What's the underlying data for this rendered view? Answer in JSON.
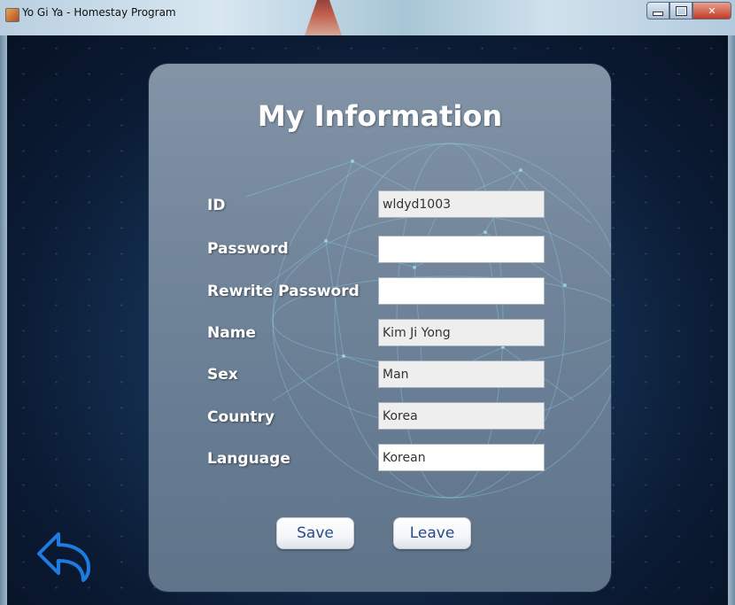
{
  "window": {
    "title": "Yo Gi Ya - Homestay Program",
    "controls": [
      "minimize-icon",
      "maximize-icon",
      "close-icon"
    ]
  },
  "panel": {
    "title": "My Information",
    "fields": [
      {
        "label": "ID",
        "value": "wldyd1003"
      },
      {
        "label": "Password",
        "value": ""
      },
      {
        "label": "Rewrite Password",
        "value": ""
      },
      {
        "label": "Name",
        "value": "Kim Ji Yong"
      },
      {
        "label": "Sex",
        "value": "Man"
      },
      {
        "label": "Country",
        "value": "Korea"
      },
      {
        "label": "Language",
        "value": "Korean"
      }
    ],
    "save_label": "Save",
    "leave_label": "Leave"
  },
  "back_button": {
    "icon": "back-arrow-icon"
  },
  "colors": {
    "background": "#0b1a33",
    "panel": "#73869b",
    "button_text": "#2b4a88",
    "accent_blue": "#1e7be0"
  }
}
